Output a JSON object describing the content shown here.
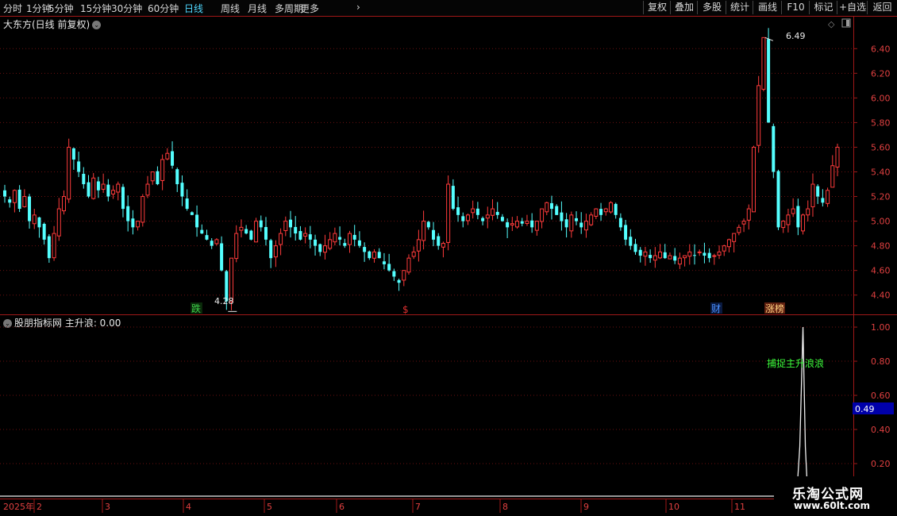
{
  "toolbar": {
    "timeframes": [
      {
        "label": "分时",
        "active": false
      },
      {
        "label": "1分钟",
        "active": false
      },
      {
        "label": "5分钟",
        "active": false
      },
      {
        "label": "15分钟",
        "active": false
      },
      {
        "label": "30分钟",
        "active": false
      },
      {
        "label": "60分钟",
        "active": false
      },
      {
        "label": "日线",
        "active": true
      },
      {
        "label": "周线",
        "active": false
      },
      {
        "label": "月线",
        "active": false
      },
      {
        "label": "多周期",
        "active": false
      },
      {
        "label": "更多",
        "active": false
      }
    ],
    "right_buttons": [
      "复权",
      "叠加",
      "多股",
      "统计",
      "画线",
      "F10",
      "标记",
      "+自选",
      "返回"
    ]
  },
  "price_panel": {
    "title": "大东方(日线 前复权)",
    "high_label": "6.49",
    "low_label": "4.28",
    "markers": [
      {
        "text": "跌",
        "color": "#3ecf4a"
      },
      {
        "text": "$",
        "color": "#e03030"
      },
      {
        "text": "财",
        "color": "#4a90ff"
      },
      {
        "text": "涨榜",
        "color": "#ffd080"
      }
    ]
  },
  "indicator_panel": {
    "title": "股朋指标网 主升浪: 0.00",
    "annotation": "捕捉主升浪浪",
    "current_value": "0.49"
  },
  "x_axis": {
    "labels": [
      "2025年",
      "2",
      "3",
      "4",
      "5",
      "6",
      "7",
      "8",
      "9",
      "10",
      "11"
    ]
  },
  "watermark": {
    "title": "乐淘公式网",
    "url": "www.60lt.com"
  },
  "colors": {
    "up": "#ff3b3b",
    "down": "#54ffff",
    "grid": "#6a1010",
    "axis": "#a01818",
    "active_tab": "#4fd8ff",
    "annotation": "#3cff3c",
    "value_box": "#0000aa"
  },
  "chart_data": [
    {
      "type": "candlestick",
      "title": "大东方(日线 前复权)",
      "ylim": [
        4.25,
        6.55
      ],
      "yticks": [
        4.4,
        4.6,
        4.8,
        5.0,
        5.2,
        5.4,
        5.6,
        5.8,
        6.0,
        6.2,
        6.4
      ],
      "ytick_labels": [
        "4.40",
        "4.60",
        "4.80",
        "5.00",
        "5.20",
        "5.40",
        "5.60",
        "5.80",
        "6.00",
        "6.20",
        "6.40"
      ],
      "high": 6.49,
      "low": 4.28,
      "closes": [
        5.2,
        5.15,
        5.25,
        5.1,
        5.2,
        5.0,
        5.05,
        4.95,
        4.85,
        4.7,
        4.9,
        5.1,
        5.2,
        5.6,
        5.5,
        5.4,
        5.3,
        5.2,
        5.35,
        5.25,
        5.3,
        5.2,
        5.25,
        5.3,
        5.1,
        5.0,
        4.95,
        5.0,
        5.2,
        5.3,
        5.4,
        5.3,
        5.5,
        5.55,
        5.45,
        5.3,
        5.2,
        5.1,
        5.05,
        4.95,
        4.9,
        4.85,
        4.8,
        4.85,
        4.6,
        4.35,
        4.7,
        4.9,
        4.95,
        4.9,
        4.85,
        5.0,
        4.95,
        4.85,
        4.7,
        4.8,
        4.9,
        5.0,
        4.95,
        4.9,
        4.85,
        4.9,
        4.85,
        4.8,
        4.75,
        4.8,
        4.85,
        4.9,
        4.85,
        4.8,
        4.9,
        4.85,
        4.8,
        4.75,
        4.7,
        4.75,
        4.7,
        4.65,
        4.6,
        4.55,
        4.5,
        4.6,
        4.7,
        4.75,
        4.85,
        5.0,
        4.95,
        4.85,
        4.8,
        4.82,
        5.3,
        5.1,
        5.05,
        5.0,
        5.05,
        5.1,
        5.05,
        5.0,
        5.05,
        5.1,
        5.05,
        5.0,
        4.95,
        4.98,
        5.0,
        4.98,
        5.0,
        4.95,
        5.0,
        5.1,
        5.15,
        5.1,
        5.05,
        5.0,
        4.95,
        5.05,
        5.0,
        4.95,
        5.0,
        5.05,
        5.1,
        5.05,
        5.1,
        5.15,
        5.05,
        4.95,
        4.85,
        4.8,
        4.75,
        4.72,
        4.75,
        4.7,
        4.72,
        4.75,
        4.7,
        4.72,
        4.68,
        4.7,
        4.72,
        4.75,
        4.72,
        4.75,
        4.72,
        4.7,
        4.72,
        4.75,
        4.8,
        4.85,
        4.9,
        4.95,
        5.0,
        5.1,
        5.6,
        6.1,
        6.49,
        5.8,
        5.4,
        4.95,
        5.0,
        5.05,
        5.1,
        4.95,
        5.05,
        5.1,
        5.3,
        5.2,
        5.15,
        5.25,
        5.45,
        5.6
      ],
      "x_labels": [
        "2025年",
        "2",
        "3",
        "4",
        "5",
        "6",
        "7",
        "8",
        "9",
        "10",
        "11"
      ]
    },
    {
      "type": "line",
      "title": "股朋指标网 主升浪: 0.00",
      "ylim": [
        0.0,
        1.07
      ],
      "yticks": [
        0.2,
        0.4,
        0.6,
        0.8,
        1.0
      ],
      "ytick_labels": [
        "0.20",
        "0.40",
        "0.60",
        "0.80",
        "1.00"
      ],
      "series": [
        {
          "name": "主升浪",
          "spike_index": 162,
          "spike_value": 1.0
        }
      ],
      "current_value": 0.49,
      "annotation": "捕捉主升浪浪"
    }
  ]
}
